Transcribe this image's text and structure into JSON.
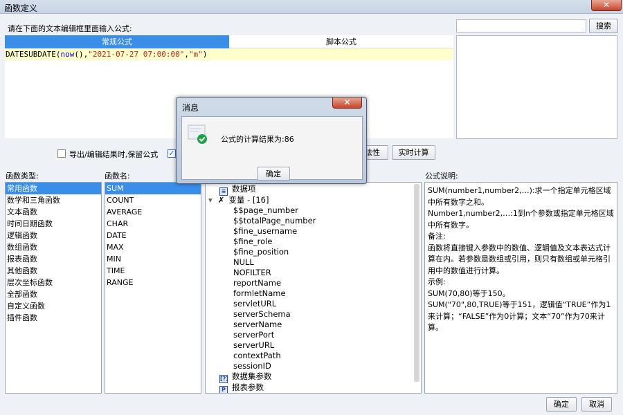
{
  "window": {
    "title": "函数定义",
    "close_glyph": "✕"
  },
  "prompt_label": "请在下面的文本编辑框里面输入公式:",
  "tabs": [
    {
      "label": "常规公式"
    },
    {
      "label": "脚本公式"
    }
  ],
  "editor": {
    "formula_fn": "DATESUBDATE",
    "formula_now": "now",
    "formula_date": "\"2021-07-27 07:00:00\"",
    "formula_unit": "\"m\""
  },
  "search": {
    "value": "",
    "button_label": "搜索"
  },
  "options": {
    "keep_formula_label": "导出/编辑结果时,保留公式",
    "check_mark": "✓"
  },
  "buttons": {
    "validity_label": "法性",
    "realtime_calc_label": "实时计算",
    "ok_label": "确定",
    "cancel_label": "取消"
  },
  "function_types": {
    "header": "函数类型:",
    "items": [
      "常用函数",
      "数学和三角函数",
      "文本函数",
      "时间日期函数",
      "逻辑函数",
      "数组函数",
      "报表函数",
      "其他函数",
      "层次坐标函数",
      "全部函数",
      "自定义函数",
      "插件函数"
    ]
  },
  "function_names": {
    "header": "函数名:",
    "items": [
      "SUM",
      "COUNT",
      "AVERAGE",
      "CHAR",
      "DATE",
      "MAX",
      "MIN",
      "TIME",
      "RANGE"
    ]
  },
  "tree": {
    "datasource": "数据项",
    "variables": "变量 - [16]",
    "variable_items": [
      "$$page_number",
      "$$totalPage_number",
      "$fine_username",
      "$fine_role",
      "$fine_position",
      "NULL",
      "NOFILTER",
      "reportName",
      "formletName",
      "servletURL",
      "serverSchema",
      "serverName",
      "serverPort",
      "serverURL",
      "contextPath",
      "sessionID"
    ],
    "dataset_params": "数据集参数",
    "report_params": "报表参数"
  },
  "description": {
    "header": "公式说明:",
    "lines": [
      "SUM(number1,number2,…):求一个指定单元格区域中所有数字之和。",
      "Number1,number2,…:1到n个参数或指定单元格区域中所有数字。",
      "备注:",
      "函数将直接键入参数中的数值、逻辑值及文本表达式计算在内。若参数是数组或引用，则只有数组或单元格引用中的数值进行计算。",
      "示例:",
      "SUM(70,80)等于150。",
      "SUM(\"70\",80,TRUE)等于151，逻辑值“TRUE”作为1来计算；“FALSE”作为0计算；文本“70”作为70来计算。"
    ]
  },
  "modal": {
    "title": "消息",
    "close_glyph": "✕",
    "message": "公式的计算结果为:86",
    "ok_label": "确定",
    "icon": "success-check-icon"
  },
  "colors": {
    "accent": "#3b8ee8",
    "code_bg": "#ffffcc",
    "success": "#1fa14a"
  }
}
